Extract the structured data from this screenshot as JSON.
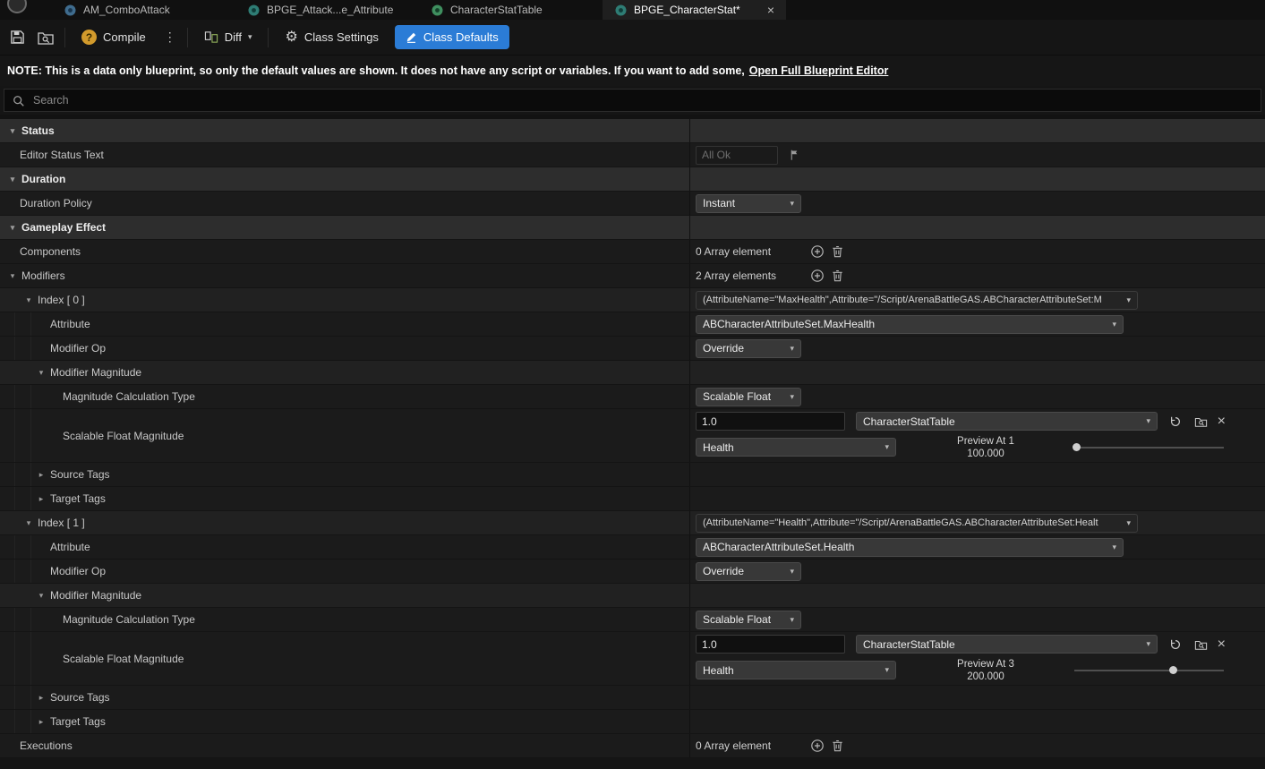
{
  "tabs": {
    "items": [
      {
        "label": "AM_ComboAttack"
      },
      {
        "label": "BPGE_Attack...e_Attribute"
      },
      {
        "label": "CharacterStatTable"
      },
      {
        "label": "BPGE_CharacterStat*"
      }
    ]
  },
  "toolbar": {
    "compile": "Compile",
    "diff": "Diff",
    "class_settings": "Class Settings",
    "class_defaults": "Class Defaults"
  },
  "note": {
    "text": "NOTE: This is a data only blueprint, so only the default values are shown.  It does not have any script or variables.  If you want to add some,",
    "link": "Open Full Blueprint Editor"
  },
  "search": {
    "placeholder": "Search"
  },
  "rows": {
    "status_header": "Status",
    "editor_status_text": "Editor Status Text",
    "editor_status_placeholder": "All Ok",
    "duration_header": "Duration",
    "duration_policy": "Duration Policy",
    "duration_policy_value": "Instant",
    "gameplay_effect_header": "Gameplay Effect",
    "components": "Components",
    "components_value": "0 Array element",
    "modifiers": "Modifiers",
    "modifiers_value": "2 Array elements",
    "executions": "Executions",
    "executions_value": "0 Array element"
  },
  "mods": [
    {
      "index_label": "Index [ 0 ]",
      "summary": "(AttributeName=\"MaxHealth\",Attribute=\"/Script/ArenaBattleGAS.ABCharacterAttributeSet:M",
      "attribute_label": "Attribute",
      "attribute_value": "ABCharacterAttributeSet.MaxHealth",
      "modifier_op_label": "Modifier Op",
      "modifier_op_value": "Override",
      "modifier_magnitude_label": "Modifier Magnitude",
      "calc_type_label": "Magnitude Calculation Type",
      "calc_type_value": "Scalable Float",
      "scalable_label": "Scalable Float Magnitude",
      "coefficient": "1.0",
      "curve_table": "CharacterStatTable",
      "row_name": "Health",
      "preview_label": "Preview At 1",
      "preview_value": "100.000",
      "slider_fraction": 0.01,
      "source_tags": "Source Tags",
      "target_tags": "Target Tags"
    },
    {
      "index_label": "Index [ 1 ]",
      "summary": "(AttributeName=\"Health\",Attribute=\"/Script/ArenaBattleGAS.ABCharacterAttributeSet:Healt",
      "attribute_label": "Attribute",
      "attribute_value": "ABCharacterAttributeSet.Health",
      "modifier_op_label": "Modifier Op",
      "modifier_op_value": "Override",
      "modifier_magnitude_label": "Modifier Magnitude",
      "calc_type_label": "Magnitude Calculation Type",
      "calc_type_value": "Scalable Float",
      "scalable_label": "Scalable Float Magnitude",
      "coefficient": "1.0",
      "curve_table": "CharacterStatTable",
      "row_name": "Health",
      "preview_label": "Preview At 3",
      "preview_value": "200.000",
      "slider_fraction": 0.66,
      "source_tags": "Source Tags",
      "target_tags": "Target Tags"
    }
  ]
}
